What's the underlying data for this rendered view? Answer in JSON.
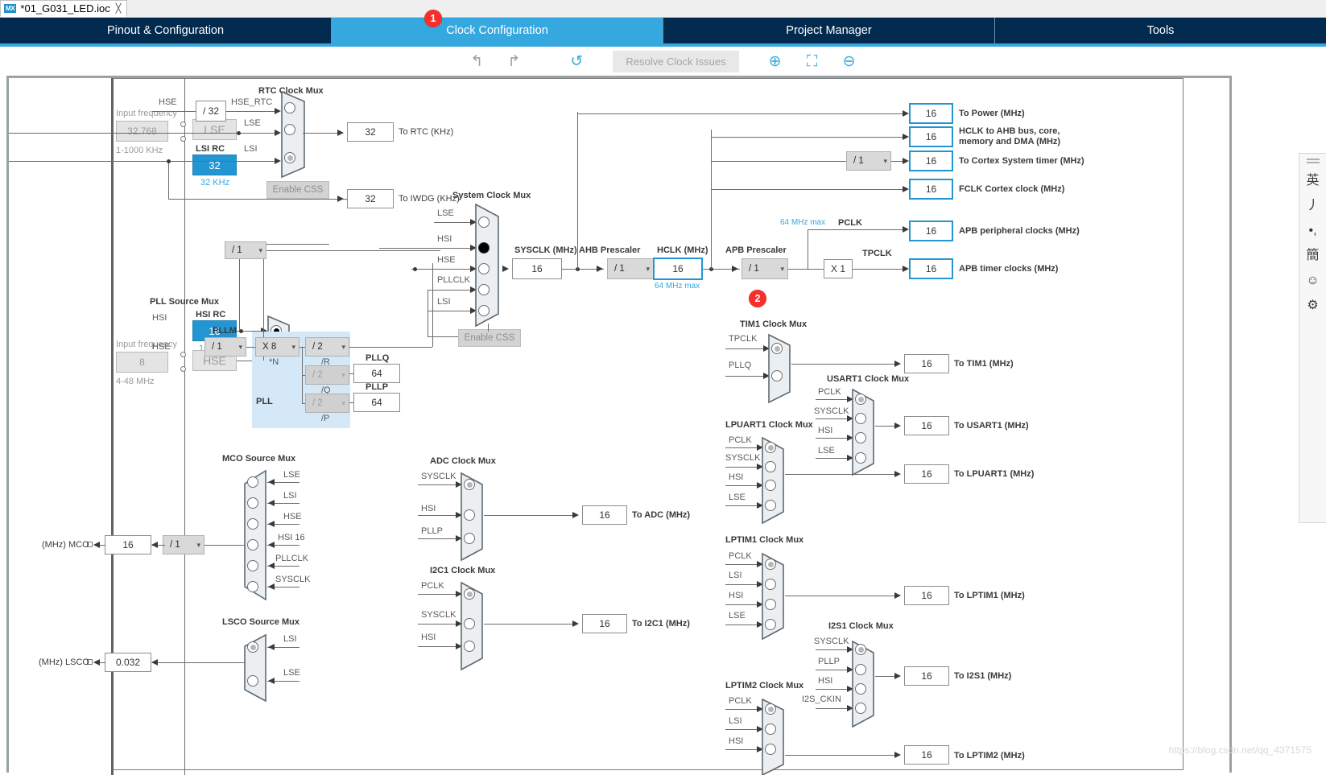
{
  "window": {
    "file_tab": "*01_G031_LED.ioc",
    "app_badge": "MX",
    "close_glyph": "✄"
  },
  "nav": {
    "tabs": [
      {
        "label": "Pinout & Configuration",
        "active": false
      },
      {
        "label": "Clock Configuration",
        "active": true
      },
      {
        "label": "Project Manager",
        "active": false
      },
      {
        "label": "Tools",
        "active": false
      }
    ]
  },
  "callouts": [
    {
      "number": "1",
      "target": "clock-configuration-tab"
    },
    {
      "number": "2",
      "target": "hclk-field"
    }
  ],
  "toolbar": {
    "undo": "↰",
    "redo": "↱",
    "refresh": "↺",
    "resolve_label": "Resolve Clock Issues",
    "zoom_in": "⊕",
    "fit": "⛶",
    "zoom_out": "⊖"
  },
  "inputs": {
    "lse": {
      "input_frequency_label": "Input frequency",
      "value": "32.768",
      "range": "1-1000 KHz",
      "name": "LSE"
    },
    "lsi": {
      "title": "LSI RC",
      "value": "32",
      "unit": "32 KHz"
    },
    "hsi": {
      "title": "HSI RC",
      "value": "16",
      "unit": "16 MHz"
    },
    "hse": {
      "input_frequency_label": "Input frequency",
      "value": "8",
      "range": "4-48 MHz",
      "name": "HSE"
    }
  },
  "rtc": {
    "mux_title": "RTC Clock Mux",
    "hse_label": "HSE",
    "divider": "/ 32",
    "hse_rtc_label": "HSE_RTC",
    "lse_label": "LSE",
    "lsi_label": "LSI",
    "enable_css": "Enable CSS",
    "rtc_value": "32",
    "rtc_out": "To RTC (KHz)",
    "iwdg_value": "32",
    "iwdg_out": "To IWDG (KHz)",
    "selected": "LSI"
  },
  "system": {
    "mux_title": "System Clock Mux",
    "inputs": [
      "LSE",
      "HSI",
      "HSE",
      "PLLCLK",
      "LSI"
    ],
    "selected": "HSI",
    "enable_css": "Enable CSS",
    "sysclk_label": "SYSCLK (MHz)",
    "sysclk_value": "16",
    "ahb_prescaler_label": "AHB Prescaler",
    "ahb_prescaler_value": "/ 1",
    "hclk_label": "HCLK (MHz)",
    "hclk_value": "16",
    "hclk_max": "64 MHz max",
    "apb_prescaler_label": "APB Prescaler",
    "apb_prescaler_value": "/ 1",
    "apb_max": "64 MHz max",
    "pclk_label": "PCLK",
    "tpclk_multiplier": "X 1",
    "tpclk_label": "TPCLK",
    "prediv_value": "/ 1"
  },
  "pll": {
    "source_mux_title": "PLL Source Mux",
    "inputs": [
      "HSI",
      "HSE"
    ],
    "selected": "HSI",
    "pll_label": "PLL",
    "pllm_label": "PLLM",
    "pllm_value": "/ 1",
    "plln_value": "X 8",
    "plln_label": "*N",
    "pllr_value": "/ 2",
    "pllr_label": "/R",
    "pllq_value": "/ 2",
    "pllq_label": "/Q",
    "pllq_out_label": "PLLQ",
    "pllq_out": "64",
    "pllp_value": "/ 2",
    "pllp_label": "/P",
    "pllp_out_label": "PLLP",
    "pllp_out": "64"
  },
  "outputs": [
    {
      "value": "16",
      "label": "To Power (MHz)"
    },
    {
      "value": "16",
      "label": "HCLK to AHB bus, core,"
    },
    {
      "value": "16",
      "label": "To Cortex System timer (MHz)"
    },
    {
      "value": "16",
      "label": "FCLK Cortex clock (MHz)"
    },
    {
      "value": "16",
      "label": "APB peripheral clocks (MHz)"
    },
    {
      "value": "16",
      "label": "APB timer clocks (MHz)"
    }
  ],
  "output_line2": "memory and DMA (MHz)",
  "mco": {
    "mux_title": "MCO Source Mux",
    "inputs": [
      "LSE",
      "LSI",
      "HSE",
      "HSI 16",
      "PLLCLK",
      "SYSCLK"
    ],
    "divider": "/ 1",
    "value": "16",
    "out_label": "(MHz) MCO"
  },
  "lsco": {
    "mux_title": "LSCO Source Mux",
    "inputs": [
      "LSI",
      "LSE"
    ],
    "value": "0.032",
    "out_label": "(MHz) LSCO"
  },
  "peripheral_muxes": [
    {
      "title": "ADC Clock Mux",
      "inputs": [
        "SYSCLK",
        "HSI",
        "PLLP"
      ],
      "selected": "SYSCLK",
      "value": "16",
      "out_label": "To ADC (MHz)"
    },
    {
      "title": "I2C1 Clock Mux",
      "inputs": [
        "PCLK",
        "SYSCLK",
        "HSI"
      ],
      "selected": "PCLK",
      "value": "16",
      "out_label": "To I2C1 (MHz)"
    },
    {
      "title": "TIM1 Clock Mux",
      "inputs": [
        "TPCLK",
        "PLLQ"
      ],
      "selected": "TPCLK",
      "value": "16",
      "out_label": "To TIM1 (MHz)"
    },
    {
      "title": "USART1 Clock Mux",
      "inputs": [
        "PCLK",
        "SYSCLK",
        "HSI",
        "LSE"
      ],
      "selected": "PCLK",
      "value": "16",
      "out_label": "To USART1 (MHz)"
    },
    {
      "title": "LPUART1 Clock Mux",
      "inputs": [
        "PCLK",
        "SYSCLK",
        "HSI",
        "LSE"
      ],
      "selected": "PCLK",
      "value": "16",
      "out_label": "To LPUART1 (MHz)"
    },
    {
      "title": "LPTIM1 Clock Mux",
      "inputs": [
        "PCLK",
        "LSI",
        "HSI",
        "LSE"
      ],
      "selected": "PCLK",
      "value": "16",
      "out_label": "To LPTIM1 (MHz)"
    },
    {
      "title": "I2S1 Clock Mux",
      "inputs": [
        "SYSCLK",
        "PLLP",
        "HSI",
        "I2S_CKIN"
      ],
      "selected": "SYSCLK",
      "value": "16",
      "out_label": "To I2S1 (MHz)"
    },
    {
      "title": "LPTIM2 Clock Mux",
      "inputs": [
        "PCLK",
        "LSI",
        "HSI"
      ],
      "selected": "PCLK",
      "value": "16",
      "out_label": "To LPTIM2 (MHz)"
    }
  ],
  "ime": {
    "items": [
      "英",
      "丿",
      "•,",
      "簡",
      "☺",
      "⚙"
    ]
  },
  "watermark": "https://blog.csdn.net/qq_4371575",
  "colors": {
    "accent": "#35a8e0",
    "navbar": "#012a4e",
    "highlight": "#2196d3",
    "callout": "#f72f2a"
  }
}
